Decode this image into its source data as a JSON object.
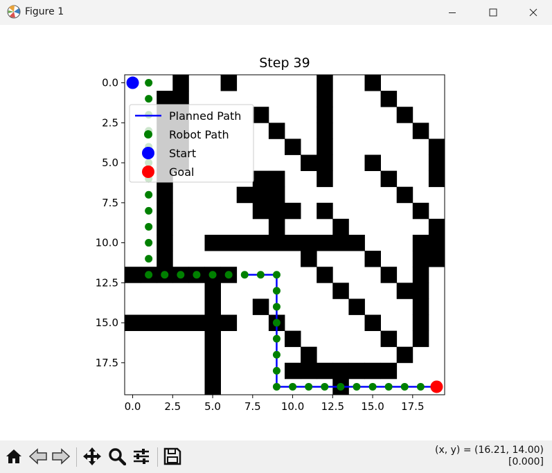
{
  "window": {
    "title": "Figure 1"
  },
  "chart_data": {
    "type": "scatter",
    "title": "Step 39",
    "xlabel": "",
    "ylabel": "",
    "xlim": [
      -0.5,
      19.5
    ],
    "ylim": [
      19.5,
      -0.5
    ],
    "x_ticks": [
      "0.0",
      "2.5",
      "5.0",
      "7.5",
      "10.0",
      "12.5",
      "15.0",
      "17.5"
    ],
    "x_tick_values": [
      0,
      2.5,
      5,
      7.5,
      10,
      12.5,
      15,
      17.5
    ],
    "y_ticks": [
      "0.0",
      "2.5",
      "5.0",
      "7.5",
      "10.0",
      "12.5",
      "15.0",
      "17.5"
    ],
    "y_tick_values": [
      0,
      2.5,
      5,
      7.5,
      10,
      12.5,
      15,
      17.5
    ],
    "grid": false,
    "legend_position": "upper-left",
    "obstacles": [
      [
        0,
        3
      ],
      [
        0,
        6
      ],
      [
        0,
        12
      ],
      [
        0,
        15
      ],
      [
        1,
        2
      ],
      [
        1,
        3
      ],
      [
        1,
        12
      ],
      [
        1,
        16
      ],
      [
        2,
        2
      ],
      [
        2,
        3
      ],
      [
        2,
        8
      ],
      [
        2,
        12
      ],
      [
        2,
        17
      ],
      [
        3,
        2
      ],
      [
        3,
        3
      ],
      [
        3,
        9
      ],
      [
        3,
        12
      ],
      [
        3,
        18
      ],
      [
        4,
        2
      ],
      [
        4,
        3
      ],
      [
        4,
        10
      ],
      [
        4,
        12
      ],
      [
        4,
        19
      ],
      [
        5,
        2
      ],
      [
        5,
        3
      ],
      [
        5,
        11
      ],
      [
        5,
        12
      ],
      [
        5,
        15
      ],
      [
        5,
        19
      ],
      [
        6,
        2
      ],
      [
        6,
        8
      ],
      [
        6,
        9
      ],
      [
        6,
        12
      ],
      [
        6,
        16
      ],
      [
        6,
        19
      ],
      [
        7,
        2
      ],
      [
        7,
        7
      ],
      [
        7,
        8
      ],
      [
        7,
        9
      ],
      [
        7,
        17
      ],
      [
        8,
        2
      ],
      [
        8,
        8
      ],
      [
        8,
        9
      ],
      [
        8,
        10
      ],
      [
        8,
        12
      ],
      [
        8,
        18
      ],
      [
        9,
        2
      ],
      [
        9,
        9
      ],
      [
        9,
        13
      ],
      [
        9,
        19
      ],
      [
        10,
        2
      ],
      [
        10,
        5
      ],
      [
        10,
        6
      ],
      [
        10,
        7
      ],
      [
        10,
        8
      ],
      [
        10,
        9
      ],
      [
        10,
        10
      ],
      [
        10,
        11
      ],
      [
        10,
        12
      ],
      [
        10,
        13
      ],
      [
        10,
        14
      ],
      [
        10,
        18
      ],
      [
        10,
        19
      ],
      [
        11,
        2
      ],
      [
        11,
        11
      ],
      [
        11,
        15
      ],
      [
        11,
        18
      ],
      [
        11,
        19
      ],
      [
        12,
        0
      ],
      [
        12,
        1
      ],
      [
        12,
        2
      ],
      [
        12,
        3
      ],
      [
        12,
        4
      ],
      [
        12,
        5
      ],
      [
        12,
        6
      ],
      [
        12,
        12
      ],
      [
        12,
        16
      ],
      [
        12,
        18
      ],
      [
        13,
        5
      ],
      [
        13,
        13
      ],
      [
        13,
        17
      ],
      [
        13,
        18
      ],
      [
        14,
        5
      ],
      [
        14,
        8
      ],
      [
        14,
        14
      ],
      [
        14,
        18
      ],
      [
        15,
        0
      ],
      [
        15,
        1
      ],
      [
        15,
        2
      ],
      [
        15,
        3
      ],
      [
        15,
        4
      ],
      [
        15,
        5
      ],
      [
        15,
        6
      ],
      [
        15,
        9
      ],
      [
        15,
        15
      ],
      [
        15,
        18
      ],
      [
        16,
        5
      ],
      [
        16,
        10
      ],
      [
        16,
        16
      ],
      [
        16,
        18
      ],
      [
        17,
        5
      ],
      [
        17,
        11
      ],
      [
        17,
        17
      ],
      [
        18,
        5
      ],
      [
        18,
        10
      ],
      [
        18,
        11
      ],
      [
        18,
        12
      ],
      [
        18,
        13
      ],
      [
        18,
        14
      ],
      [
        18,
        15
      ],
      [
        18,
        16
      ],
      [
        19,
        5
      ],
      [
        19,
        13
      ]
    ],
    "series": [
      {
        "name": "Planned Path",
        "kind": "line",
        "color": "#0000ff",
        "x": [
          7,
          8,
          9,
          9,
          9,
          9,
          9,
          9,
          9,
          9,
          10,
          11,
          12,
          13,
          14,
          15,
          16,
          17,
          18,
          19
        ],
        "y": [
          12,
          12,
          12,
          13,
          14,
          15,
          16,
          17,
          18,
          19,
          19,
          19,
          19,
          19,
          19,
          19,
          19,
          19,
          19,
          19
        ]
      },
      {
        "name": "Robot Path",
        "kind": "scatter",
        "color": "#008000",
        "x": [
          1,
          1,
          1,
          1,
          1,
          1,
          1,
          1,
          1,
          1,
          1,
          1,
          1,
          2,
          3,
          4,
          5,
          6,
          7,
          8,
          9,
          9,
          9,
          9,
          9,
          9,
          9,
          9,
          10,
          11,
          12,
          13,
          14,
          15,
          16,
          17,
          18
        ],
        "y": [
          0,
          1,
          2,
          3,
          4,
          5,
          6,
          7,
          8,
          9,
          10,
          11,
          12,
          12,
          12,
          12,
          12,
          12,
          12,
          12,
          12,
          13,
          14,
          15,
          16,
          17,
          18,
          19,
          19,
          19,
          19,
          19,
          19,
          19,
          19,
          19,
          19
        ]
      },
      {
        "name": "Start",
        "kind": "marker",
        "color": "#0000ff",
        "x": [
          0
        ],
        "y": [
          0
        ]
      },
      {
        "name": "Goal",
        "kind": "marker",
        "color": "#ff0000",
        "x": [
          19
        ],
        "y": [
          19
        ]
      }
    ]
  },
  "toolbar": {
    "buttons": [
      {
        "name": "home-button",
        "icon": "home-icon"
      },
      {
        "name": "back-button",
        "icon": "arrow-left-icon"
      },
      {
        "name": "forward-button",
        "icon": "arrow-right-icon"
      },
      {
        "name": "pan-button",
        "icon": "move-icon"
      },
      {
        "name": "zoom-button",
        "icon": "magnifier-icon"
      },
      {
        "name": "configure-subplots-button",
        "icon": "sliders-icon"
      },
      {
        "name": "save-button",
        "icon": "floppy-disk-icon"
      }
    ],
    "coords_line1": "(x, y) = (16.21, 14.00)",
    "coords_line2": "[0.000]"
  }
}
